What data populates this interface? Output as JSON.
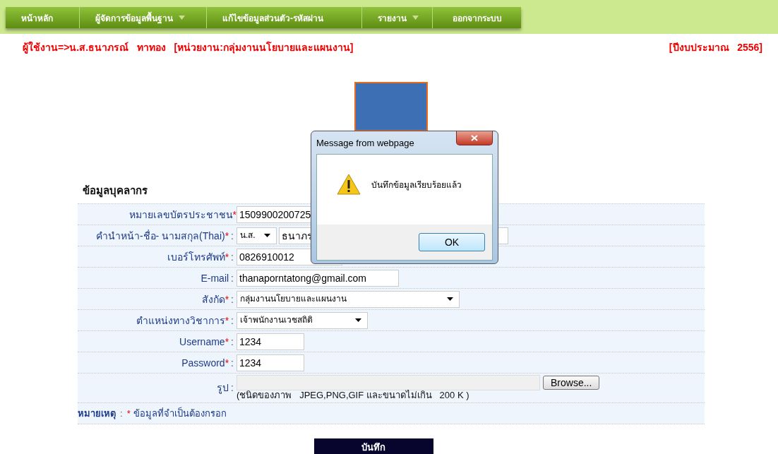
{
  "nav": [
    {
      "label": "หน้าหลัก",
      "dropdown": false
    },
    {
      "label": "ผู้จัดการข้อมูลพื้นฐาน",
      "dropdown": true
    },
    {
      "label": "แก้ไขข้อมูลส่วนตัว-รหัสผ่าน",
      "dropdown": false
    },
    {
      "label": "รายงาน",
      "dropdown": true
    },
    {
      "label": "ออกจากระบบ",
      "dropdown": false
    }
  ],
  "user_line": "ผู้ใช้งาน=>น.ส.ธนาภรณ์   ทาทอง   [หน่วยงาน:กลุ่มงานนโยบายและแผนงาน]",
  "budget_year": "[ปีงบประมาณ   2556]",
  "form": {
    "title": "ข้อมูลบุคลากร",
    "fields": [
      {
        "kind": "text",
        "label": "หมายเลขบัตรประชาชน",
        "mark": "*",
        "value": "1509900200725"
      },
      {
        "kind": "name",
        "label": "คำนำหน้า-ชื่อ- นามสกุล(Thai)",
        "mark": "*",
        "colon": ":",
        "prefix": "น.ส.",
        "first_name": "ธนาภร"
      },
      {
        "kind": "text",
        "label": "เบอร์โทรศัพท์",
        "mark": "*",
        "colon": ":",
        "value": "0826910012"
      },
      {
        "kind": "text",
        "label": "E-mail",
        "colon": ":",
        "value": "thanaporntatong@gmail.com"
      },
      {
        "kind": "select",
        "label": "สังกัด",
        "mark": "*",
        "colon": ":",
        "value": "กลุ่มงานนโยบายและแผนงาน"
      },
      {
        "kind": "select",
        "label": "ตำแหน่งทางวิชาการ",
        "mark": "*",
        "colon": ":",
        "value": "เจ้าพนักงานเวชสถิติ"
      },
      {
        "kind": "text",
        "label": "Username",
        "mark": "*",
        "colon": ":",
        "value": "1234"
      },
      {
        "kind": "text",
        "label": "Password",
        "mark": "*",
        "colon": ":",
        "value": "1234"
      },
      {
        "kind": "file",
        "label": "รูป",
        "colon": ":",
        "button": "Browse...",
        "hint": "(ชนิดของภาพ   JPEG,PNG,GIF และขนาดไม่เกิน   200 K )"
      }
    ],
    "note": {
      "label": "หมายเหตุ",
      "colon": ":",
      "mark": "*",
      "text": "ข้อมูลที่จำเป็นต้องกรอก"
    },
    "submit": "บันทึก"
  },
  "dialog": {
    "title": "Message from webpage",
    "message": "บันทึกข้อมูลเรียบร้อยแล้ว",
    "ok": "OK"
  }
}
